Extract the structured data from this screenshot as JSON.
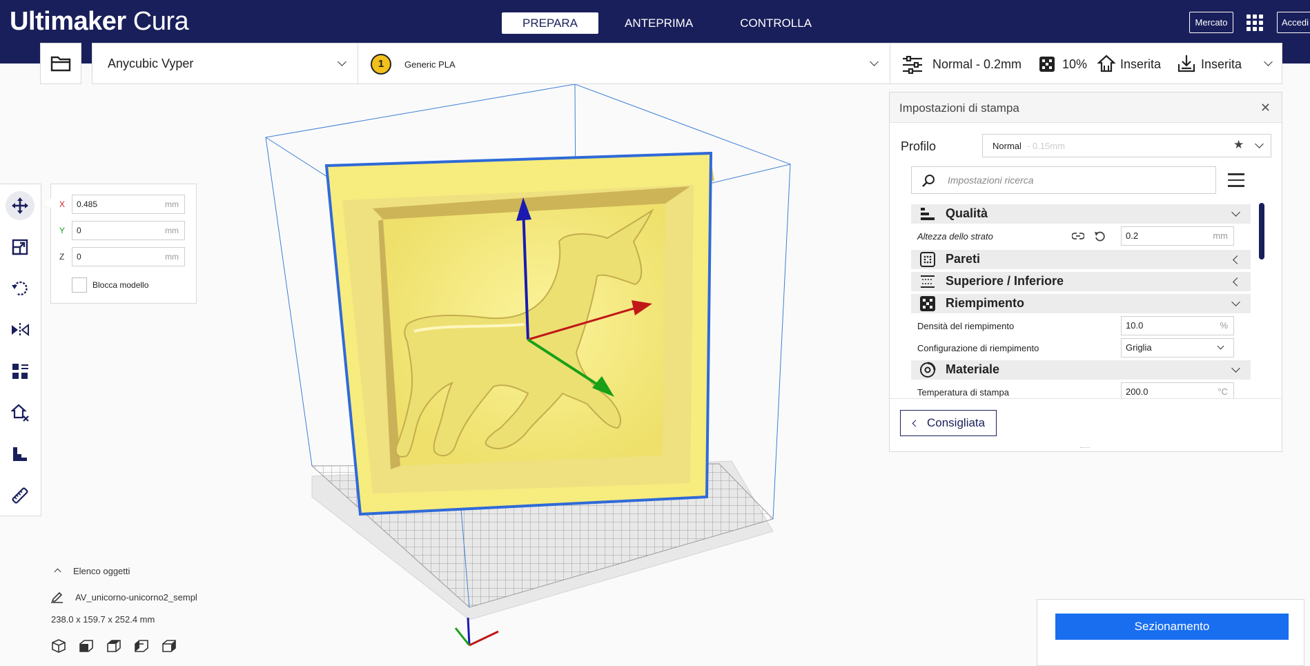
{
  "app": {
    "logo_bold": "Ultimaker",
    "logo_light": "Cura"
  },
  "stages": [
    {
      "label": "PREPARA",
      "active": true
    },
    {
      "label": "ANTEPRIMA",
      "active": false
    },
    {
      "label": "CONTROLLA",
      "active": false
    }
  ],
  "header": {
    "market_label": "Mercato",
    "login_label": "Accedi"
  },
  "printer": {
    "name": "Anycubic Vyper"
  },
  "material": {
    "extruder_number": "1",
    "name": "Generic PLA"
  },
  "settings_summary": {
    "profile": "Normal - 0.2mm",
    "infill": "10%",
    "support": "Inserita",
    "adhesion": "Inserita"
  },
  "transform": {
    "x_label": "X",
    "x_value": "0.485",
    "y_label": "Y",
    "y_value": "0",
    "z_label": "Z",
    "z_value": "0",
    "unit": "mm",
    "lock_label": "Blocca modello"
  },
  "print_settings": {
    "title": "Impostazioni di stampa",
    "profile_label": "Profilo",
    "profile_value": "Normal",
    "profile_sub": "- 0.15mm",
    "search_placeholder": "Impostazioni ricerca",
    "categories": {
      "quality": "Qualità",
      "walls": "Pareti",
      "topbottom": "Superiore / Inferiore",
      "infill": "Riempimento",
      "material": "Materiale"
    },
    "settings": {
      "layer_height_label": "Altezza dello strato",
      "layer_height_value": "0.2",
      "layer_height_unit": "mm",
      "infill_density_label": "Densità del riempimento",
      "infill_density_value": "10.0",
      "infill_density_unit": "%",
      "infill_pattern_label": "Configurazione di riempimento",
      "infill_pattern_value": "Griglia",
      "print_temp_label": "Temperatura di stampa",
      "print_temp_value": "200.0",
      "print_temp_unit": "°C"
    },
    "recommended_label": "Consigliata"
  },
  "slice": {
    "label": "Sezionamento"
  },
  "objects": {
    "title": "Elenco oggetti",
    "name": "AV_unicorno-unicorno2_sempl",
    "dims": "238.0 x 159.7 x 252.4 mm"
  },
  "colors": {
    "header_bg": "#191f5a",
    "accent_blue": "#196ef0",
    "model_yellow": "#f7ea7a"
  }
}
